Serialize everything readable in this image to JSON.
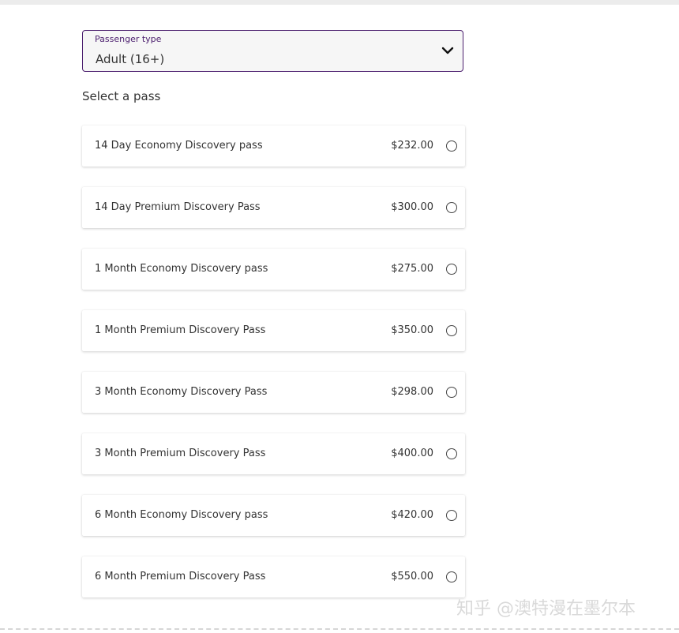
{
  "passenger_type": {
    "label": "Passenger type",
    "value": "Adult (16+)",
    "accent_color": "#4b1e6e"
  },
  "section_title": "Select a pass",
  "passes": [
    {
      "name": "14 Day Economy Discovery pass",
      "price": "$232.00",
      "selected": false
    },
    {
      "name": "14 Day Premium Discovery Pass",
      "price": "$300.00",
      "selected": false
    },
    {
      "name": "1 Month Economy Discovery pass",
      "price": "$275.00",
      "selected": false
    },
    {
      "name": "1 Month Premium Discovery Pass",
      "price": "$350.00",
      "selected": false
    },
    {
      "name": "3 Month Economy Discovery Pass",
      "price": "$298.00",
      "selected": false
    },
    {
      "name": "3 Month Premium Discovery Pass",
      "price": "$400.00",
      "selected": false
    },
    {
      "name": "6 Month Economy Discovery pass",
      "price": "$420.00",
      "selected": false
    },
    {
      "name": "6 Month Premium Discovery Pass",
      "price": "$550.00",
      "selected": false
    }
  ],
  "watermark": "知乎 @澳特漫在墨尔本",
  "icons": {
    "dropdown": "chevron-down-icon",
    "radio": "radio-unchecked-icon"
  }
}
